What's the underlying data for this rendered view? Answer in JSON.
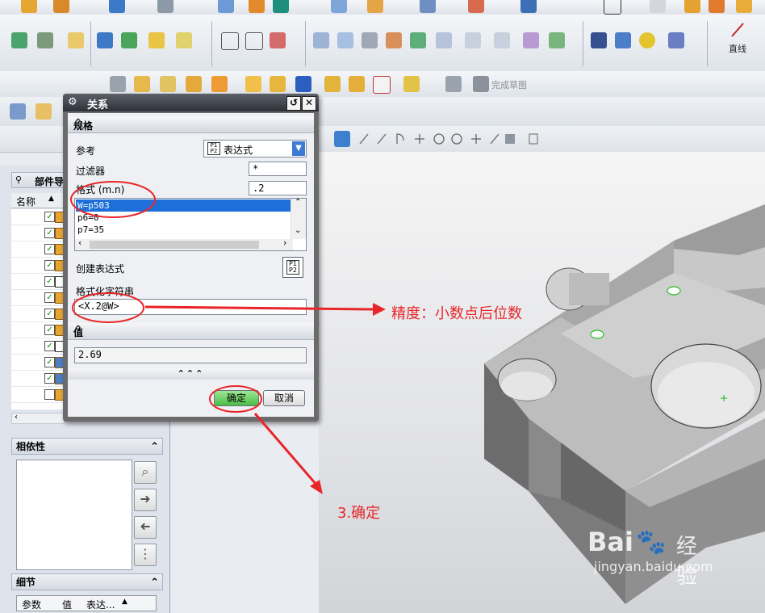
{
  "toolbar": {
    "finish_sketch_label": "完成草图",
    "line_label": "直线"
  },
  "nav": {
    "part_navigator_title": "部件导",
    "name_col": "名称"
  },
  "dependency": {
    "title": "相依性"
  },
  "details": {
    "title": "细节",
    "columns": [
      "参数",
      "值",
      "表达..."
    ]
  },
  "dialog": {
    "title": "关系",
    "spec_section": "规格",
    "reference_label": "参考",
    "reference_value": "表达式",
    "filter_label": "过滤器",
    "filter_value": "*",
    "format_label": "格式 (m.n)",
    "format_value": ".2",
    "list_items": [
      "W=p503",
      "p6=0",
      "p7=35"
    ],
    "create_expression_label": "创建表达式",
    "format_string_label": "格式化字符串",
    "format_string_value": "<X.2@W>",
    "value_section": "值",
    "value": "2.69",
    "ok_label": "确定",
    "cancel_label": "取消"
  },
  "annotations": {
    "precision": "精度：小数点后位数",
    "step3": "3.确定"
  },
  "watermark": {
    "brand": "Bai",
    "brand2": "经验",
    "url": "jingyan.baidu.com"
  },
  "colors": {
    "annotation_red": "#e8262a",
    "selection_blue": "#1e6fd9",
    "ok_green": "#5fcf5a"
  }
}
